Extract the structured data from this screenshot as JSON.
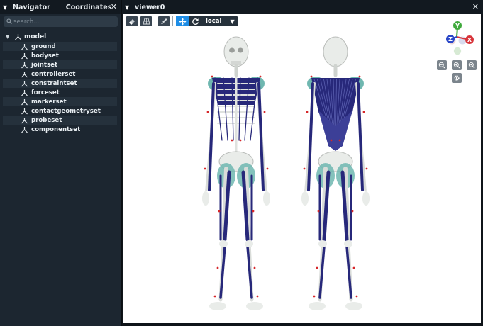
{
  "left_panel": {
    "tabs": [
      "Navigator",
      "Coordinates"
    ],
    "close_icon": "✕",
    "search": {
      "placeholder": "search...",
      "value": ""
    },
    "tree": {
      "root": {
        "label": "model",
        "expanded": true
      },
      "children": [
        "ground",
        "bodyset",
        "jointset",
        "controllerset",
        "constraintset",
        "forceset",
        "markerset",
        "contactgeometryset",
        "probeset",
        "componentset"
      ]
    }
  },
  "viewer": {
    "title": "viewer0",
    "close_icon": "✕",
    "toolbar": {
      "icons": [
        "eraser-icon",
        "grid-floor-icon",
        "ruler-icon"
      ],
      "manip_modes": [
        "move-icon",
        "rotate-icon"
      ],
      "coord_space": "local"
    },
    "axes": {
      "x": "X",
      "y": "Y",
      "z": "Z",
      "x_color": "#d8343a",
      "y_color": "#3fa93c",
      "z_color": "#2a47c8"
    }
  },
  "colors": {
    "muscle": "#27287a",
    "bone": "#e9ece9",
    "tendon": "#6fb7b0",
    "marker": "#d6272a",
    "accent": "#1e8de6"
  }
}
